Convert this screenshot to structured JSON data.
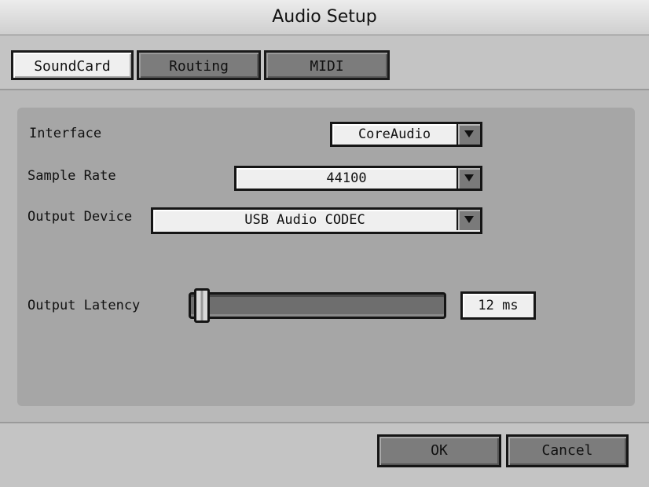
{
  "window": {
    "title": "Audio Setup"
  },
  "tabs": [
    {
      "label": "SoundCard",
      "active": true
    },
    {
      "label": "Routing",
      "active": false
    },
    {
      "label": "MIDI",
      "active": false
    }
  ],
  "soundcard": {
    "interface": {
      "label": "Interface",
      "value": "CoreAudio"
    },
    "sample_rate": {
      "label": "Sample Rate",
      "value": "44100"
    },
    "output_device": {
      "label": "Output Device",
      "value": "USB Audio CODEC"
    },
    "output_latency": {
      "label": "Output Latency",
      "value": "12 ms",
      "slider_level": 0.02
    }
  },
  "footer": {
    "ok_label": "OK",
    "cancel_label": "Cancel"
  },
  "icons": {
    "dropdown_arrow": "chevron-down-icon"
  }
}
